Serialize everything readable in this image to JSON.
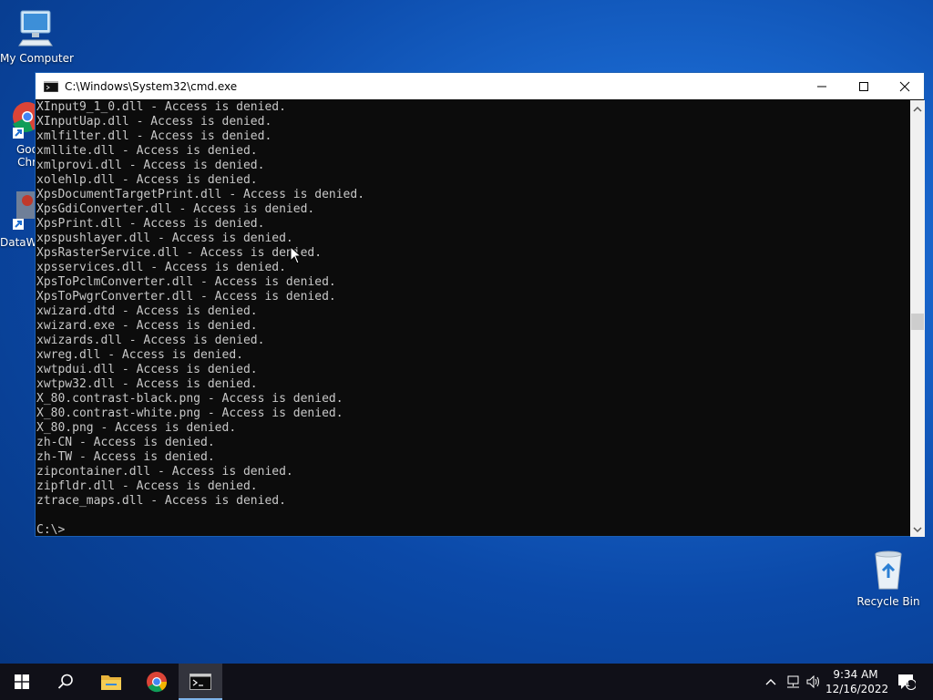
{
  "desktop": {
    "icons": [
      {
        "label": "My Computer"
      },
      {
        "label": "Goo\nChr"
      },
      {
        "label": "DataW"
      },
      {
        "label": "Recycle Bin"
      }
    ]
  },
  "window": {
    "title": "C:\\Windows\\System32\\cmd.exe",
    "console_lines": [
      "XInput9_1_0.dll - Access is denied.",
      "XInputUap.dll - Access is denied.",
      "xmlfilter.dll - Access is denied.",
      "xmllite.dll - Access is denied.",
      "xmlprovi.dll - Access is denied.",
      "xolehlp.dll - Access is denied.",
      "XpsDocumentTargetPrint.dll - Access is denied.",
      "XpsGdiConverter.dll - Access is denied.",
      "XpsPrint.dll - Access is denied.",
      "xpspushlayer.dll - Access is denied.",
      "XpsRasterService.dll - Access is denied.",
      "xpsservices.dll - Access is denied.",
      "XpsToPclmConverter.dll - Access is denied.",
      "XpsToPwgrConverter.dll - Access is denied.",
      "xwizard.dtd - Access is denied.",
      "xwizard.exe - Access is denied.",
      "xwizards.dll - Access is denied.",
      "xwreg.dll - Access is denied.",
      "xwtpdui.dll - Access is denied.",
      "xwtpw32.dll - Access is denied.",
      "X_80.contrast-black.png - Access is denied.",
      "X_80.contrast-white.png - Access is denied.",
      "X_80.png - Access is denied.",
      "zh-CN - Access is denied.",
      "zh-TW - Access is denied.",
      "zipcontainer.dll - Access is denied.",
      "zipfldr.dll - Access is denied.",
      "ztrace_maps.dll - Access is denied.",
      "",
      "C:\\>"
    ]
  },
  "taskbar": {
    "time": "9:34 AM",
    "date": "12/16/2022",
    "notification_count": "1"
  }
}
